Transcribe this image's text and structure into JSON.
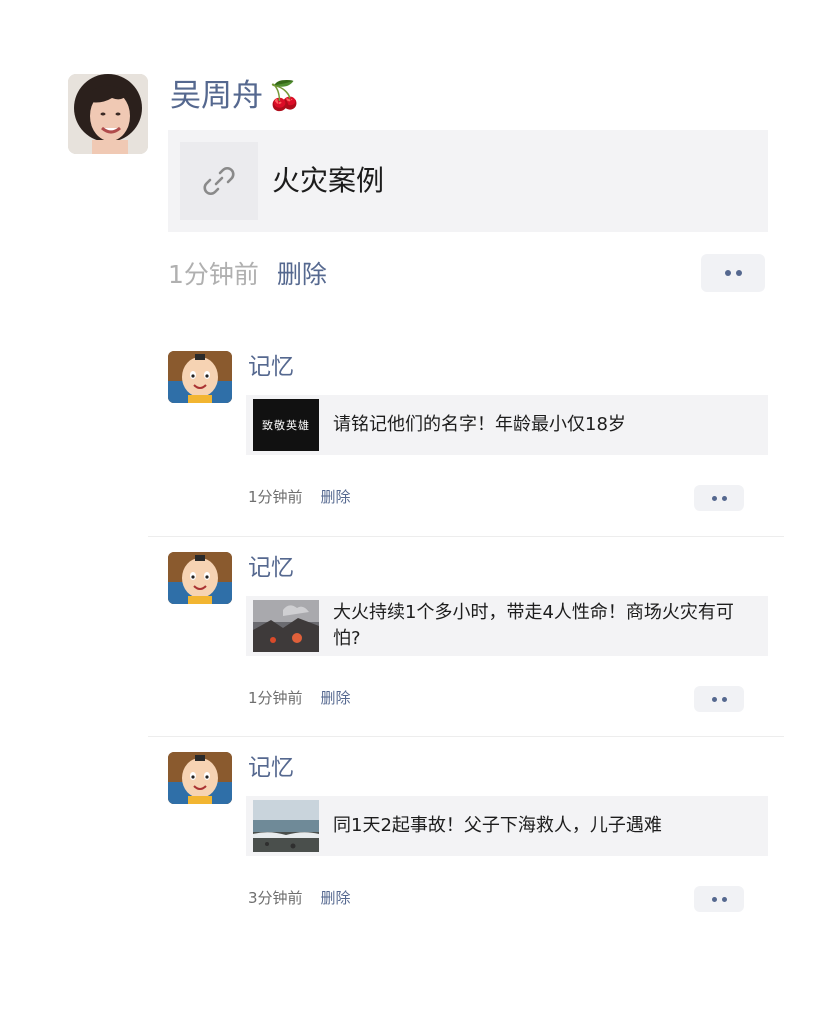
{
  "post": {
    "author": "吴周舟",
    "author_emoji": "🍒",
    "link_title": "火灾案例",
    "time": "1分钟前",
    "delete_label": "删除",
    "more_icon": "more-dots-icon"
  },
  "shares": [
    {
      "author": "记忆",
      "thumb_text": "致敬英雄",
      "title": "请铭记他们的名字！年龄最小仅18岁",
      "time": "1分钟前",
      "delete_label": "删除"
    },
    {
      "author": "记忆",
      "thumb_text": "",
      "title": "大火持续1个多小时，带走4人性命！商场火灾有可怕?",
      "time": "1分钟前",
      "delete_label": "删除"
    },
    {
      "author": "记忆",
      "thumb_text": "",
      "title": "同1天2起事故！父子下海救人，儿子遇难",
      "time": "3分钟前",
      "delete_label": "删除"
    }
  ],
  "colors": {
    "link_blue": "#55688f",
    "card_bg": "#f3f3f5",
    "muted": "#b0b0b0"
  }
}
